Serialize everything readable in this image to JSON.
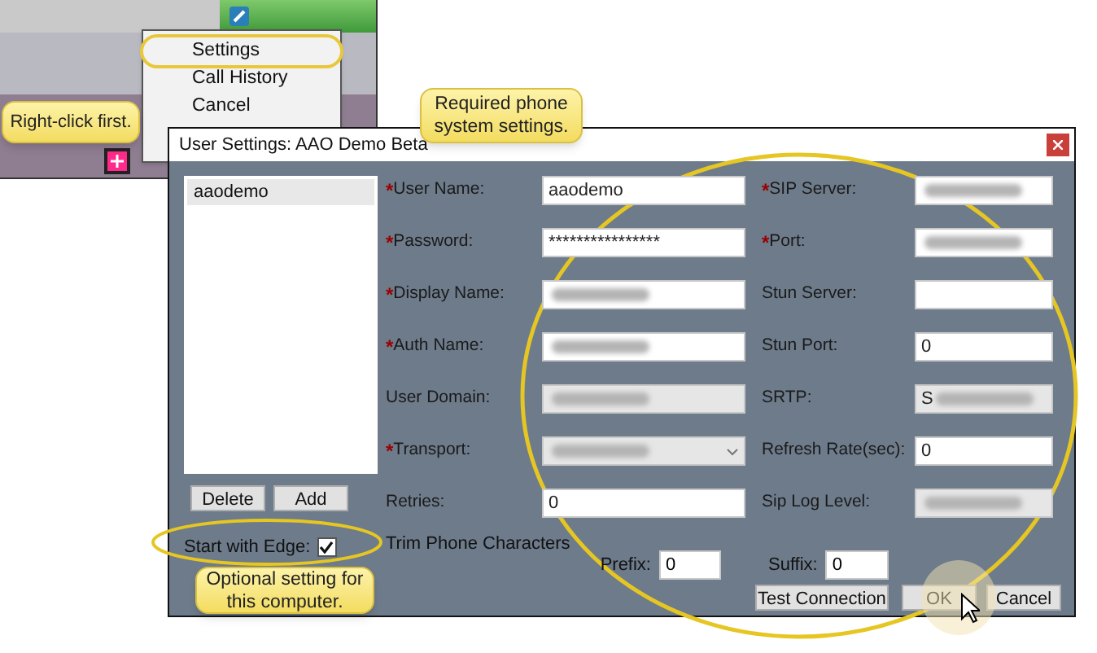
{
  "context_menu": {
    "items": [
      {
        "label": "Settings",
        "highlighted": true
      },
      {
        "label": "Call History",
        "highlighted": false
      },
      {
        "label": "Cancel",
        "highlighted": false
      }
    ]
  },
  "callouts": [
    {
      "text": "Right-click first."
    },
    {
      "text": "Required phone system settings."
    },
    {
      "text": "Optional setting for this computer."
    }
  ],
  "dialog": {
    "title": "User Settings: AAO Demo Beta",
    "accounts": [
      {
        "name": "aaodemo",
        "selected": true
      }
    ],
    "list_buttons": [
      "Delete",
      "Add"
    ],
    "start_with_edge": {
      "label": "Start with Edge:",
      "checked": true
    },
    "fields_left": [
      {
        "label": "User Name:",
        "required_mark": "*",
        "kind": "text",
        "disabled": false,
        "value": "aaodemo",
        "blurred": false
      },
      {
        "label": "Password:",
        "required_mark": "*",
        "kind": "text",
        "disabled": false,
        "value": "****************",
        "blurred": false
      },
      {
        "label": "Display Name:",
        "required_mark": "*",
        "kind": "text",
        "disabled": false,
        "blurred": true
      },
      {
        "label": "Auth Name:",
        "required_mark": "*",
        "kind": "text",
        "disabled": false,
        "blurred": true
      },
      {
        "label": "User Domain:",
        "kind": "text",
        "disabled": true,
        "blurred": true
      },
      {
        "label": "Transport:",
        "required_mark": "*",
        "kind": "select",
        "disabled": true,
        "blurred": true
      },
      {
        "label": "Retries:",
        "kind": "text",
        "disabled": false,
        "value": "0",
        "blurred": false
      }
    ],
    "fields_right": [
      {
        "label": "SIP Server:",
        "required_mark": "*",
        "kind": "text",
        "disabled": false,
        "blurred": true
      },
      {
        "label": "Port:",
        "required_mark": "*",
        "kind": "text",
        "disabled": false,
        "blurred": true
      },
      {
        "label": "Stun Server:",
        "kind": "text",
        "disabled": false,
        "blurred": false
      },
      {
        "label": "Stun Port:",
        "kind": "text",
        "disabled": false,
        "value": "0",
        "blurred": false
      },
      {
        "label": "SRTP:",
        "kind": "text",
        "disabled": true,
        "value": "S",
        "blurred": true
      },
      {
        "label": "Refresh Rate(sec):",
        "kind": "text",
        "disabled": false,
        "value": "0",
        "blurred": false
      },
      {
        "label": "Sip Log Level:",
        "kind": "text",
        "disabled": true,
        "blurred": true
      }
    ],
    "trim": {
      "label": "Trim Phone Characters",
      "prefix": {
        "label": "Prefix:",
        "value": "0"
      },
      "suffix": {
        "label": "Suffix:",
        "value": "0"
      }
    },
    "buttons": [
      "Test Connection",
      "OK",
      "Cancel"
    ]
  }
}
